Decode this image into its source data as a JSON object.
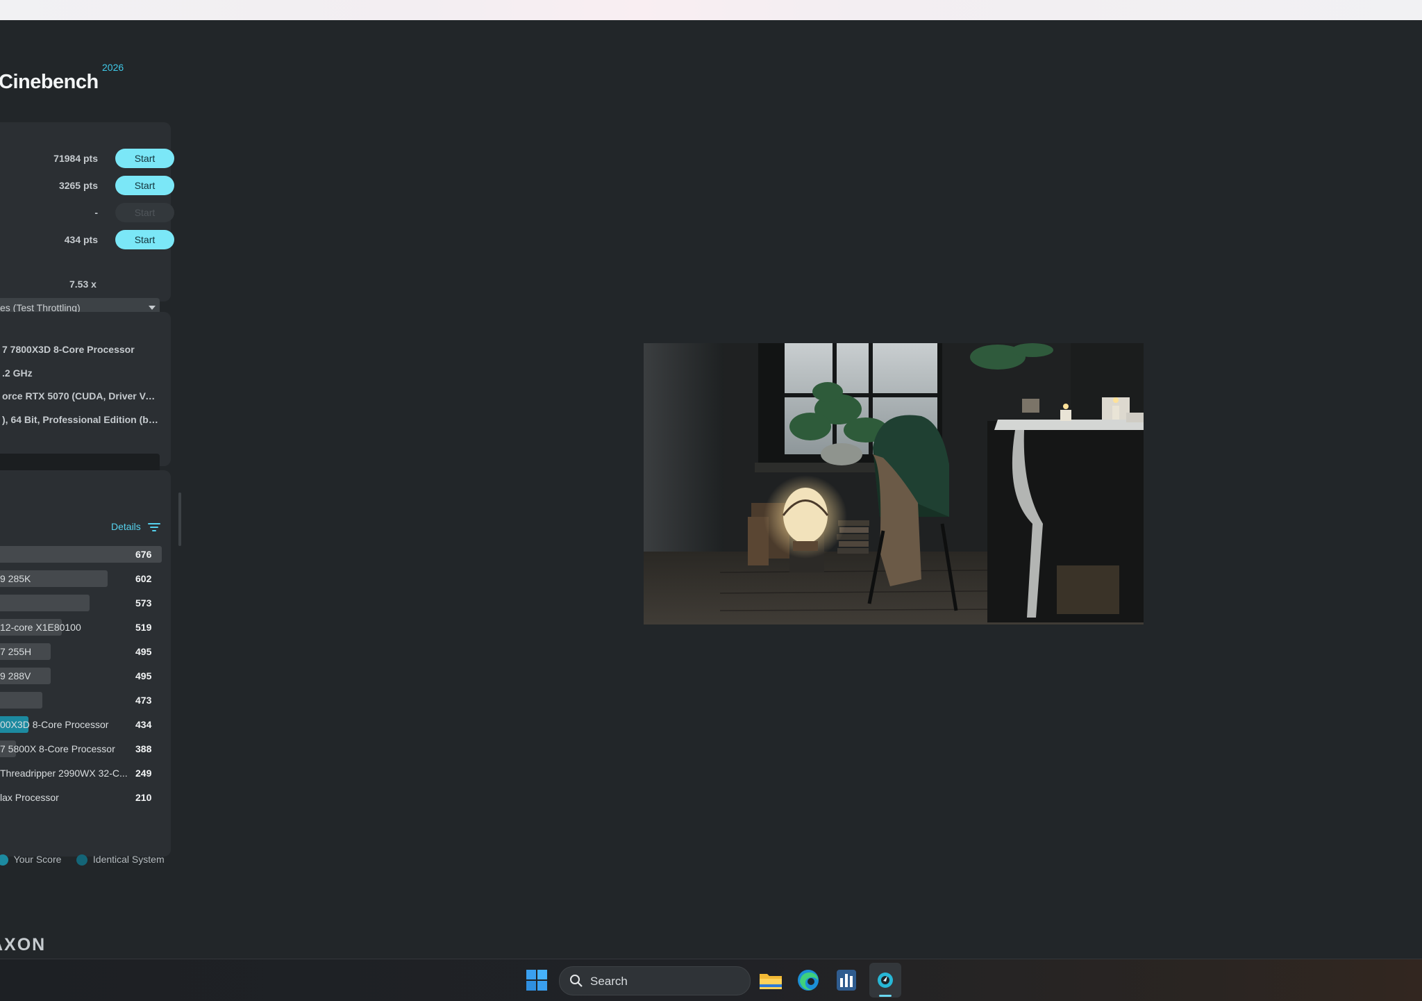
{
  "app": {
    "title": "Cinebench",
    "year": "2026"
  },
  "tests": [
    {
      "score": "71984 pts",
      "button": "Start",
      "enabled": true
    },
    {
      "score": "3265 pts",
      "button": "Start",
      "enabled": true
    },
    {
      "score": "-",
      "button": "Start",
      "enabled": false
    },
    {
      "score": "434 pts",
      "button": "Start",
      "enabled": true
    }
  ],
  "mp_ratio": "7.53 x",
  "duration_select": {
    "value": "es (Test Throttling)"
  },
  "system": {
    "cpu": "7 7800X3D 8-Core Processor",
    "clock": ".2 GHz",
    "gpu": "orce RTX 5070 (CUDA, Driver Vers...",
    "os": "), 64 Bit, Professional Edition (buil..."
  },
  "ranking": {
    "details_label": "Details",
    "rows": [
      {
        "name": "",
        "score": "676",
        "own": false
      },
      {
        "name": "9 285K",
        "score": "602",
        "own": false
      },
      {
        "name": "",
        "score": "573",
        "own": false
      },
      {
        "name": "12-core X1E80100",
        "score": "519",
        "own": false
      },
      {
        "name": "7 255H",
        "score": "495",
        "own": false
      },
      {
        "name": "9 288V",
        "score": "495",
        "own": false
      },
      {
        "name": "",
        "score": "473",
        "own": false
      },
      {
        "name": "00X3D 8-Core Processor",
        "score": "434",
        "own": true
      },
      {
        "name": "7 5800X 8-Core Processor",
        "score": "388",
        "own": false
      },
      {
        "name": "Threadripper 2990WX 32-C...",
        "score": "249",
        "own": false
      },
      {
        "name": "lax Processor",
        "score": "210",
        "own": false
      }
    ],
    "legend": {
      "your_score": "Your Score",
      "your_color": "#1c8aa0",
      "identical": "Identical System",
      "identical_color": "#146577"
    }
  },
  "footer_logo": "AXON",
  "taskbar": {
    "search_label": "Search",
    "icons": [
      "windows-start-icon",
      "search-icon",
      "file-explorer-icon",
      "edge-browser-icon",
      "task-manager-icon",
      "cinebench-icon"
    ]
  }
}
